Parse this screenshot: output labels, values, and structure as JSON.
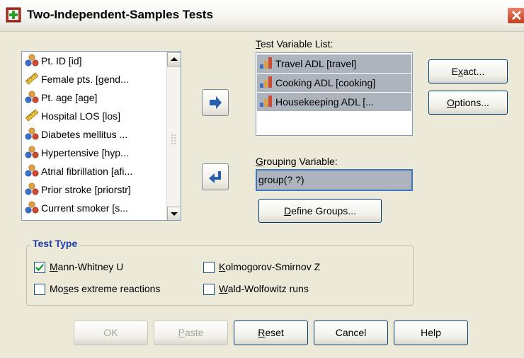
{
  "window": {
    "title": "Two-Independent-Samples Tests",
    "close_glyph": "✕"
  },
  "source_list": {
    "items": [
      {
        "label": "Pt. ID [id]",
        "icon": "nominal-variable-icon"
      },
      {
        "label": "Female pts. [gend...",
        "icon": "scale-ruler-icon"
      },
      {
        "label": "Pt. age [age]",
        "icon": "nominal-variable-icon"
      },
      {
        "label": "Hospital LOS [los]",
        "icon": "scale-ruler-icon"
      },
      {
        "label": "Diabetes mellitus ...",
        "icon": "nominal-variable-icon"
      },
      {
        "label": "Hypertensive [hyp...",
        "icon": "nominal-variable-icon"
      },
      {
        "label": "Atrial fibrillation [afi...",
        "icon": "nominal-variable-icon"
      },
      {
        "label": "Prior stroke [priorstr]",
        "icon": "nominal-variable-icon"
      },
      {
        "label": "Current smoker [s...",
        "icon": "nominal-variable-icon"
      }
    ]
  },
  "test_variable_list": {
    "label_u": "T",
    "label_rest": "est Variable List:",
    "items": [
      {
        "label": "Travel ADL [travel]",
        "icon": "ordinal-bar-icon"
      },
      {
        "label": "Cooking ADL [cooking]",
        "icon": "ordinal-bar-icon"
      },
      {
        "label": "Housekeeping ADL [...",
        "icon": "ordinal-bar-icon"
      }
    ]
  },
  "grouping_variable": {
    "label_u": "G",
    "label_rest": "rouping Variable:",
    "value": "group(? ?)"
  },
  "buttons": {
    "exact": {
      "pre": "E",
      "u": "x",
      "post": "act..."
    },
    "options": {
      "pre": "",
      "u": "O",
      "post": "ptions..."
    },
    "define_groups": {
      "pre": "",
      "u": "D",
      "post": "efine Groups..."
    },
    "ok": {
      "label": "OK"
    },
    "paste": {
      "pre": "",
      "u": "P",
      "post": "aste"
    },
    "reset": {
      "pre": "",
      "u": "R",
      "post": "eset"
    },
    "cancel": {
      "label": "Cancel"
    },
    "help": {
      "label": "Help"
    }
  },
  "test_type": {
    "title": "Test Type",
    "options": [
      {
        "pre": "",
        "u": "M",
        "post": "ann-Whitney U",
        "checked": true
      },
      {
        "pre": "",
        "u": "K",
        "post": "olmogorov-Smirnov Z",
        "checked": false
      },
      {
        "pre": "Mo",
        "u": "s",
        "post": "es extreme reactions",
        "checked": false
      },
      {
        "pre": "",
        "u": "W",
        "post": "ald-Wolfowitz runs",
        "checked": false
      }
    ]
  },
  "colors": {
    "selection": "#aeb4be",
    "highlight_border": "#3b78c4",
    "group_title": "#1c3fa8"
  }
}
